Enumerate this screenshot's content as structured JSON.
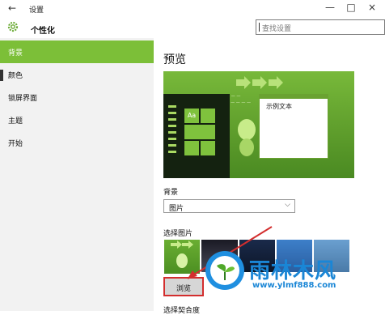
{
  "window": {
    "back_icon": "back-arrow-icon",
    "title": "设置",
    "minimize": "—",
    "maximize": "□",
    "close": "×"
  },
  "header": {
    "icon": "gear-icon",
    "title": "个性化",
    "search_placeholder": "查找设置"
  },
  "sidebar": {
    "items": [
      {
        "label": "背景",
        "active": true
      },
      {
        "label": "颜色",
        "active": false
      },
      {
        "label": "锁屏界面",
        "active": false
      },
      {
        "label": "主题",
        "active": false
      },
      {
        "label": "开始",
        "active": false
      }
    ]
  },
  "main": {
    "heading": "预览",
    "preview": {
      "sample_text": "示例文本",
      "tile_label": "Aa",
      "colors": {
        "green": "#78b93a",
        "dark": "#142210"
      }
    },
    "background_label": "背景",
    "background_value": "图片",
    "choose_picture_label": "选择图片",
    "browse_label": "浏览",
    "fit_label": "选择契合度"
  },
  "watermark": {
    "title": "雨林木风",
    "url": "www.ylmf888.com",
    "color": "#1a86d6"
  },
  "accent": "#7cbf38",
  "annotation_color": "#d32e2e"
}
